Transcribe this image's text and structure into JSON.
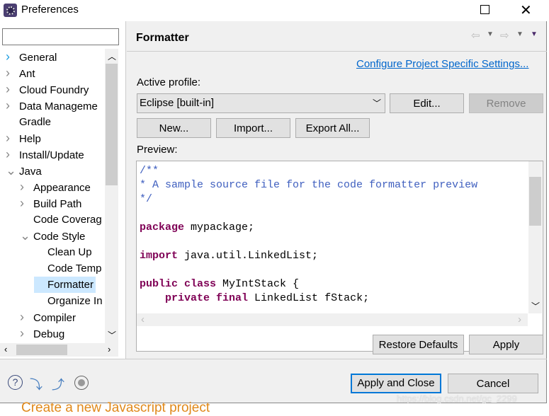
{
  "window": {
    "title": "Preferences",
    "icon": "eclipse-gear-icon"
  },
  "filter": {
    "value": ""
  },
  "tree": [
    {
      "label": "General",
      "level": 0,
      "chevron": "right",
      "accent": true
    },
    {
      "label": "Ant",
      "level": 0,
      "chevron": "right"
    },
    {
      "label": "Cloud Foundry",
      "level": 0,
      "chevron": "right"
    },
    {
      "label": "Data Manageme",
      "level": 0,
      "chevron": "right"
    },
    {
      "label": "Gradle",
      "level": 0,
      "chevron": ""
    },
    {
      "label": "Help",
      "level": 0,
      "chevron": "right"
    },
    {
      "label": "Install/Update",
      "level": 0,
      "chevron": "right"
    },
    {
      "label": "Java",
      "level": 0,
      "chevron": "down"
    },
    {
      "label": "Appearance",
      "level": 1,
      "chevron": "right"
    },
    {
      "label": "Build Path",
      "level": 1,
      "chevron": "right"
    },
    {
      "label": "Code Coverag",
      "level": 1,
      "chevron": ""
    },
    {
      "label": "Code Style",
      "level": 1,
      "chevron": "down"
    },
    {
      "label": "Clean Up",
      "level": 2,
      "chevron": ""
    },
    {
      "label": "Code Temp",
      "level": 2,
      "chevron": ""
    },
    {
      "label": "Formatter",
      "level": 2,
      "chevron": "",
      "selected": true
    },
    {
      "label": "Organize In",
      "level": 2,
      "chevron": ""
    },
    {
      "label": "Compiler",
      "level": 1,
      "chevron": "right"
    },
    {
      "label": "Debug",
      "level": 1,
      "chevron": "right"
    }
  ],
  "page": {
    "title": "Formatter",
    "configure_link": "Configure Project Specific Settings...",
    "active_profile_label": "Active profile:",
    "profile_selected": "Eclipse [built-in]",
    "edit": "Edit...",
    "remove": "Remove",
    "new": "New...",
    "import": "Import...",
    "export_all": "Export All...",
    "preview_label": "Preview:",
    "code": [
      {
        "parts": [
          {
            "t": "/**",
            "c": "cm"
          }
        ]
      },
      {
        "parts": [
          {
            "t": "* A sample source file for the code formatter preview",
            "c": "cm"
          }
        ]
      },
      {
        "parts": [
          {
            "t": "*/",
            "c": "cm"
          }
        ]
      },
      {
        "parts": []
      },
      {
        "parts": [
          {
            "t": "package",
            "c": "kw"
          },
          {
            "t": " mypackage;",
            "c": ""
          }
        ]
      },
      {
        "parts": []
      },
      {
        "parts": [
          {
            "t": "import",
            "c": "kw"
          },
          {
            "t": " java.util.LinkedList;",
            "c": ""
          }
        ]
      },
      {
        "parts": []
      },
      {
        "parts": [
          {
            "t": "public class",
            "c": "kw"
          },
          {
            "t": " MyIntStack {",
            "c": ""
          }
        ]
      },
      {
        "parts": [
          {
            "t": "    ",
            "c": ""
          },
          {
            "t": "private final",
            "c": "kw"
          },
          {
            "t": " LinkedList fStack;",
            "c": ""
          }
        ]
      }
    ],
    "restore_defaults": "Restore Defaults",
    "apply": "Apply"
  },
  "footer": {
    "apply_close": "Apply and Close",
    "cancel": "Cancel"
  },
  "background": {
    "text": "Create a new Javascript project",
    "watermark": "https://blog.csdn.net/gc_2299"
  },
  "colors": {
    "link": "#0066cc",
    "selection": "#cce8ff",
    "focus": "#0078d7",
    "bg_orange": "#e0891a"
  }
}
